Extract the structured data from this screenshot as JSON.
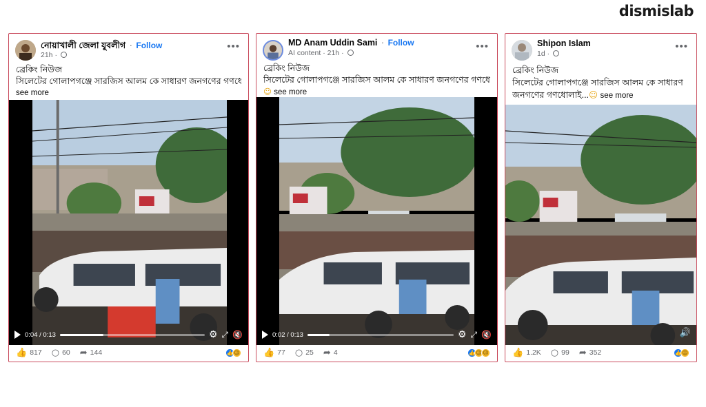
{
  "brand": "dismislab",
  "posts": [
    {
      "author": "নোয়াখালী জেলা যুবলীগ",
      "follow": "Follow",
      "time": "21h",
      "text_line1": "ব্রেকিং নিউজ",
      "text_line2": "সিলেটের গোলাপগঞ্জে সারজিস আলম কে সাধারণ জনগণের গণধোলাই...",
      "see_more": "see more",
      "video_time": "0:04 / 0:13",
      "progress": 0.3,
      "likes": "817",
      "comments": "60",
      "shares": "144",
      "reactions": [
        "like-icon",
        "haha-icon"
      ]
    },
    {
      "author": "MD Anam Uddin Sami",
      "follow": "Follow",
      "label": "AI content",
      "time": "21h",
      "text_line1": "ব্রেকিং নিউজ",
      "text_line2": "সিলেটের গোলাপগঞ্জে সারজিস আলম কে সাধারণ জনগণের গণধোলাই...",
      "see_more": "see more",
      "video_time": "0:02 / 0:13",
      "progress": 0.15,
      "likes": "77",
      "comments": "25",
      "shares": "4",
      "reactions": [
        "like-icon",
        "haha-icon",
        "sad-icon"
      ]
    },
    {
      "author": "Shipon Islam",
      "time": "1d",
      "text_line1": "ব্রেকিং নিউজ",
      "text_line2": "সিলেটের গোলাপগঞ্জে সারজিস আলম কে সাধারণ",
      "text_line3": "জনগণের গণধোলাই...",
      "see_more": "see more",
      "likes": "1.2K",
      "comments": "99",
      "shares": "352",
      "reactions": [
        "like-icon",
        "haha-icon"
      ]
    }
  ],
  "colors": {
    "frame": "#c94a5c",
    "follow": "#1877f2",
    "video_bg": "#000000"
  }
}
